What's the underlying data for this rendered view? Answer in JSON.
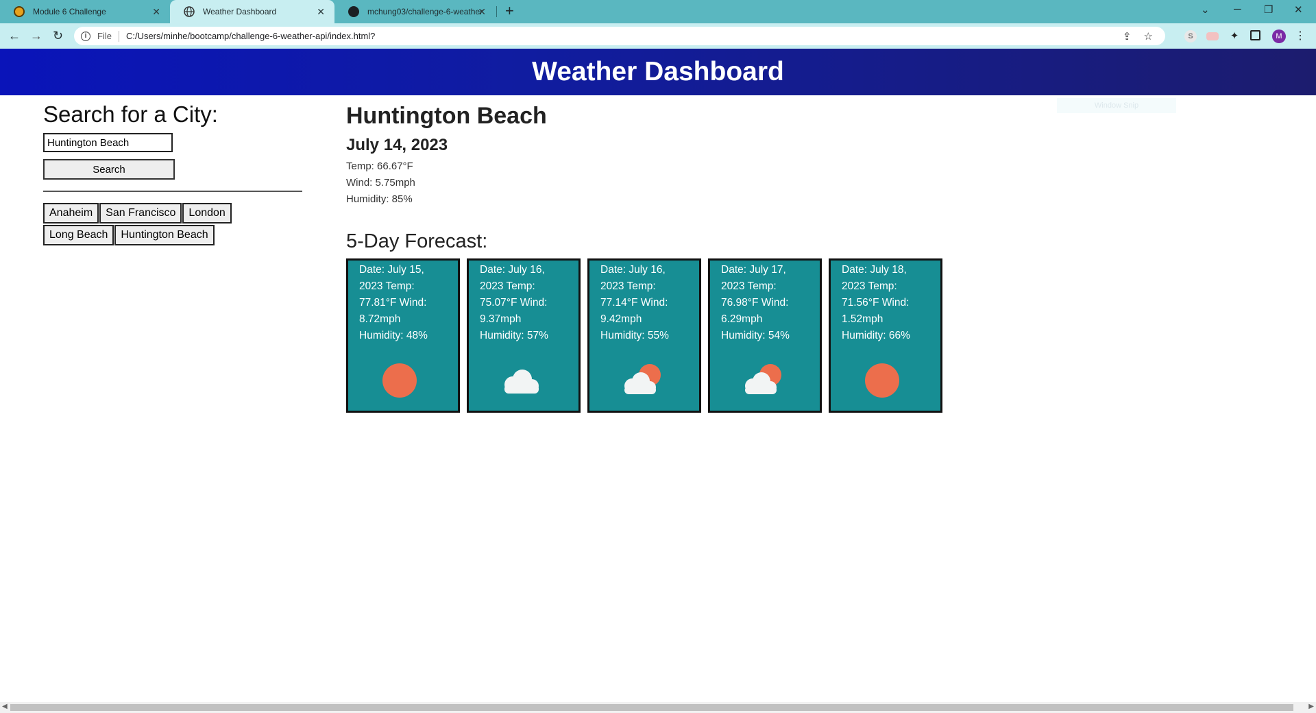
{
  "browser": {
    "tabs": [
      {
        "title": "Module 6 Challenge",
        "favicon": "bootcamp-logo-icon",
        "active": false
      },
      {
        "title": "Weather Dashboard",
        "favicon": "globe-icon",
        "active": true
      },
      {
        "title": "mchung03/challenge-6-weather",
        "favicon": "github-icon",
        "active": false
      }
    ],
    "new_tab_label": "+",
    "address": {
      "file_chip": "File",
      "url": "C:/Users/minhe/bootcamp/challenge-6-weather-api/index.html?"
    },
    "profile_initial": "M",
    "extension_letter": "S"
  },
  "header": {
    "title": "Weather Dashboard"
  },
  "search": {
    "heading": "Search for a City:",
    "input_value": "Huntington Beach",
    "button_label": "Search",
    "history": [
      "Anaheim",
      "San Francisco",
      "London",
      "Long Beach",
      "Huntington Beach"
    ]
  },
  "current": {
    "city": "Huntington Beach",
    "date": "July 14, 2023",
    "temp": "Temp: 66.67°F",
    "wind": "Wind: 5.75mph",
    "humidity": "Humidity: 85%"
  },
  "forecast": {
    "heading": "5-Day Forecast:",
    "days": [
      {
        "text": "Date: July 15, 2023 Temp: 77.81°F Wind: 8.72mph Humidity: 48%",
        "icon": "sun-icon"
      },
      {
        "text": "Date: July 16, 2023 Temp: 75.07°F Wind: 9.37mph Humidity: 57%",
        "icon": "cloud-icon"
      },
      {
        "text": "Date: July 16, 2023 Temp: 77.14°F Wind: 9.42mph Humidity: 55%",
        "icon": "partly-cloudy-icon"
      },
      {
        "text": "Date: July 17, 2023 Temp: 76.98°F Wind: 6.29mph Humidity: 54%",
        "icon": "partly-cloudy-icon"
      },
      {
        "text": "Date: July 18, 2023 Temp: 71.56°F Wind: 1.52mph Humidity: 66%",
        "icon": "sun-icon"
      }
    ]
  },
  "overlay": {
    "snip_label": "Window Snip"
  },
  "colors": {
    "header_start": "#0a14b9",
    "header_end": "#1c1c6e",
    "card_bg": "#178e94",
    "sun": "#ec6e4c",
    "tabbar": "#5ab7c0"
  }
}
